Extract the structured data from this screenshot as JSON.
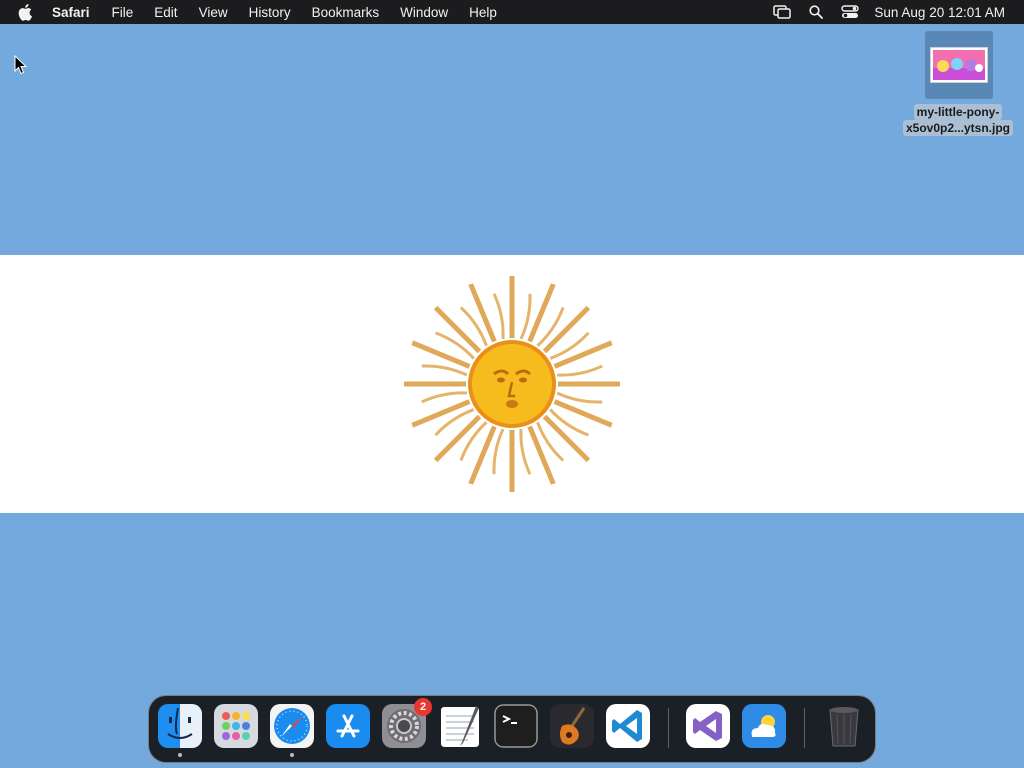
{
  "menubar": {
    "app_name": "Safari",
    "items": [
      "File",
      "Edit",
      "View",
      "History",
      "Bookmarks",
      "Window",
      "Help"
    ],
    "clock": "Sun Aug 20  12:01 AM",
    "status_icons": [
      "screen-mirroring-icon",
      "spotlight-search-icon",
      "control-center-icon"
    ]
  },
  "desktop": {
    "file": {
      "line1": "my-little-pony-",
      "line2": "x5ov0p2...ytsn.jpg"
    }
  },
  "dock": {
    "apps": [
      {
        "name": "Finder",
        "icon": "finder-icon",
        "running": true
      },
      {
        "name": "Launchpad",
        "icon": "launchpad-icon",
        "running": false
      },
      {
        "name": "Safari",
        "icon": "safari-icon",
        "running": true
      },
      {
        "name": "App Store",
        "icon": "app-store-icon",
        "running": false
      },
      {
        "name": "System Settings",
        "icon": "system-settings-icon",
        "running": false,
        "badge": "2"
      },
      {
        "name": "TextEdit",
        "icon": "textedit-icon",
        "running": false
      },
      {
        "name": "Terminal",
        "icon": "terminal-icon",
        "running": false
      },
      {
        "name": "GarageBand",
        "icon": "garageband-icon",
        "running": false
      },
      {
        "name": "Visual Studio Code",
        "icon": "vscode-icon",
        "running": false
      },
      {
        "name": "Visual Studio",
        "icon": "visual-studio-icon",
        "running": false
      },
      {
        "name": "Weather",
        "icon": "weather-icon",
        "running": false
      },
      {
        "name": "Trash",
        "icon": "trash-icon",
        "running": false
      }
    ]
  },
  "colors": {
    "sky_blue": "#74a9dd",
    "white": "#ffffff",
    "sun_gold": "#f0a81c"
  }
}
